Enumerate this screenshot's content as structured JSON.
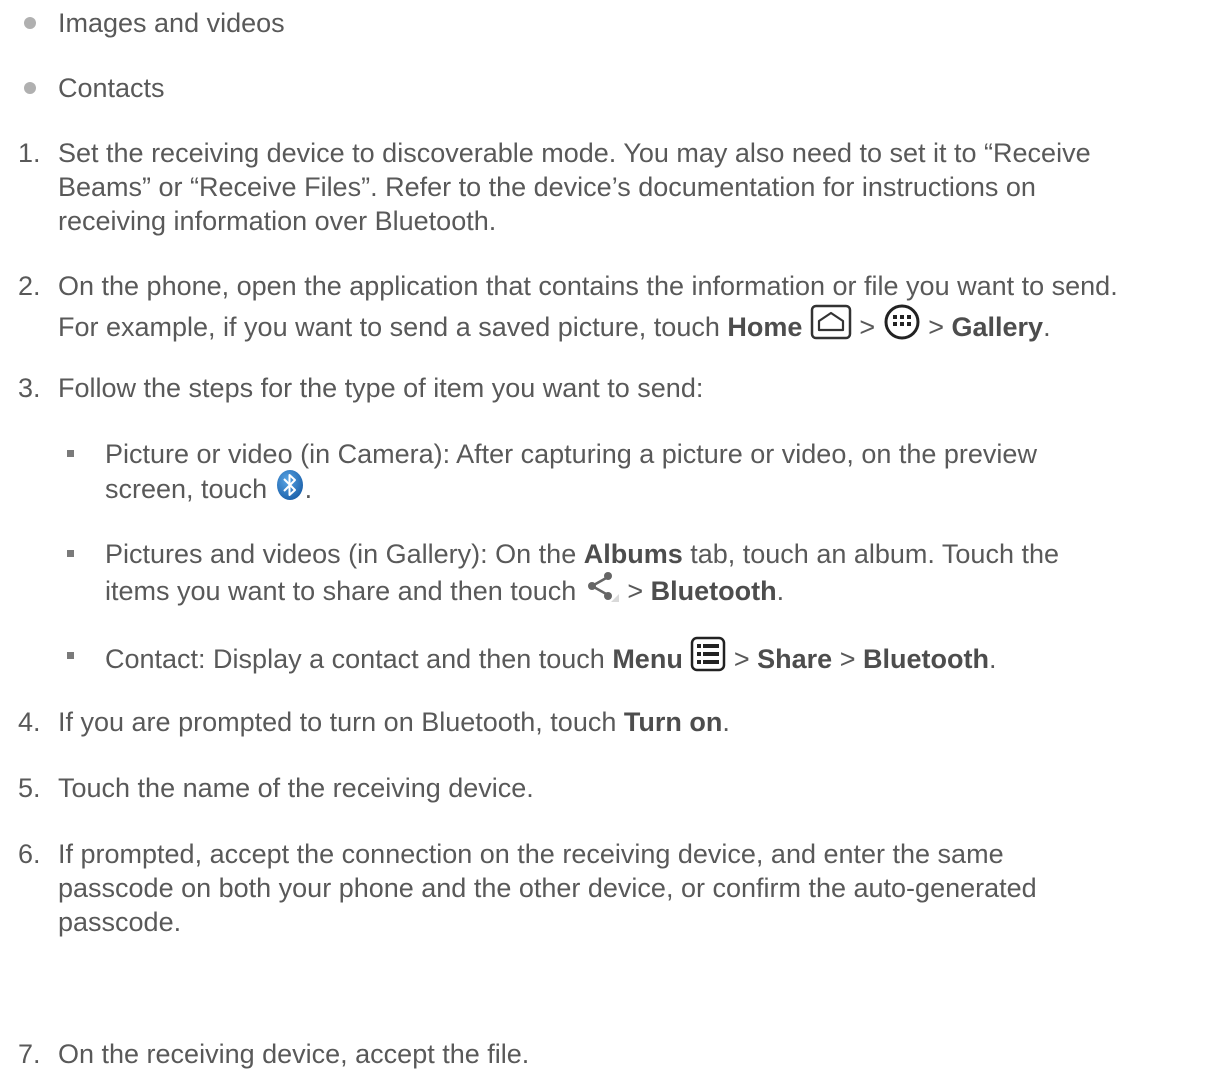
{
  "bullets": [
    "Images and videos",
    "Contacts"
  ],
  "steps": {
    "1": {
      "num": "1.",
      "l1": "Set the receiving device to discoverable mode. You may also need to set it to “Receive",
      "l2": "Beams” or “Receive Files”. Refer to the device’s documentation for instructions on",
      "l3": "receiving information over Bluetooth."
    },
    "2": {
      "num": "2.",
      "l1": "On the phone, open the application that contains the information or file you want to send.",
      "l2_pre": "For example, if you want to send a saved picture, touch ",
      "home": "Home",
      "gt": ">",
      "gallery": "Gallery",
      "period": "."
    },
    "3": {
      "num": "3.",
      "l1": "Follow the steps for the type of item you want to send:",
      "sub1_l1": "Picture or video (in Camera): After capturing a picture or video, on the preview",
      "sub1_l2": "screen, touch ",
      "sub2_l1_pre": "Pictures and videos (in Gallery): On the ",
      "albums": "Albums",
      "sub2_l1_post": " tab, touch an album. Touch the",
      "sub2_l2_pre": "items you want to share and then touch ",
      "bluetooth": "Bluetooth",
      "sub3_pre": "Contact: Display a contact and then touch ",
      "menu": "Menu",
      "share": "Share"
    },
    "4": {
      "num": "4.",
      "pre": "If you are prompted to turn on Bluetooth, touch ",
      "turn_on": "Turn on"
    },
    "5": {
      "num": "5.",
      "text": "Touch the name of the receiving device."
    },
    "6": {
      "num": "6.",
      "l1": "If prompted, accept the connection on the receiving device, and enter the same",
      "l2": "passcode on both your phone and the other device, or confirm the auto-generated",
      "l3": "passcode."
    },
    "7": {
      "num": "7.",
      "text": "On the receiving device, accept the file."
    }
  },
  "colors": {
    "text": "#595959",
    "bold": "#4d4d4d",
    "bluetooth_icon": "#1f6fb8"
  },
  "icons": [
    "home-icon",
    "apps-icon",
    "bluetooth-icon",
    "share-icon",
    "menu-icon"
  ]
}
